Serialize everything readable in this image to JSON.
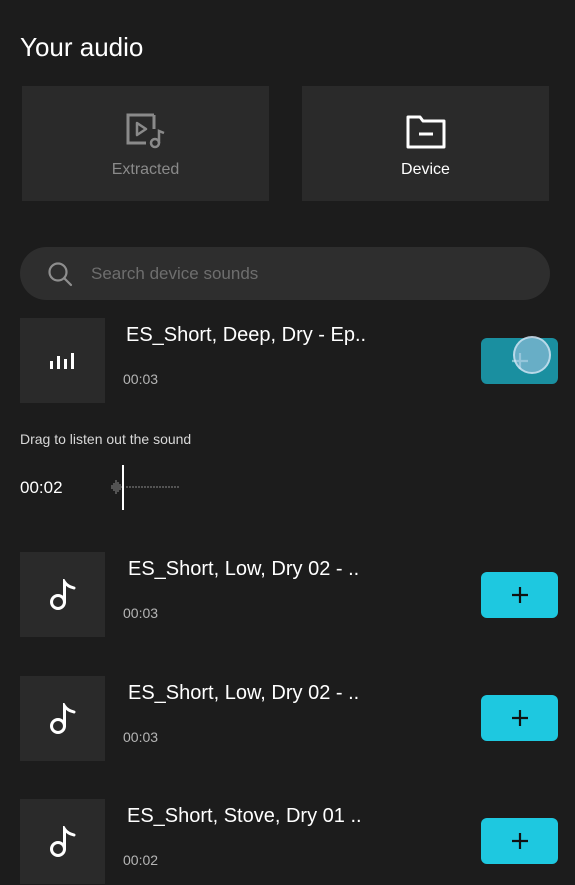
{
  "header": {
    "title": "Your audio"
  },
  "sources": [
    {
      "label": "Extracted",
      "icon": "video-music-icon",
      "active": false
    },
    {
      "label": "Device",
      "icon": "folder-icon",
      "active": true
    }
  ],
  "search": {
    "placeholder": "Search device sounds",
    "value": ""
  },
  "preview": {
    "hint": "Drag to listen out the sound",
    "time": "00:02"
  },
  "tracks": [
    {
      "name": "ES_Short, Deep, Dry - Ep..",
      "duration": "00:03",
      "icon": "equalizer-icon",
      "playing": true
    },
    {
      "name": "ES_Short, Low, Dry 02 - ..",
      "duration": "00:03",
      "icon": "music-note-icon",
      "playing": false
    },
    {
      "name": "ES_Short, Low, Dry 02 - ..",
      "duration": "00:03",
      "icon": "music-note-icon",
      "playing": false
    },
    {
      "name": "ES_Short, Stove, Dry 01 ..",
      "duration": "00:02",
      "icon": "music-note-icon",
      "playing": false
    }
  ],
  "colors": {
    "background": "#1c1c1c",
    "tile": "#2a2a2a",
    "accent": "#1ec8e0",
    "accent_pressed": "#1a8fa0"
  }
}
